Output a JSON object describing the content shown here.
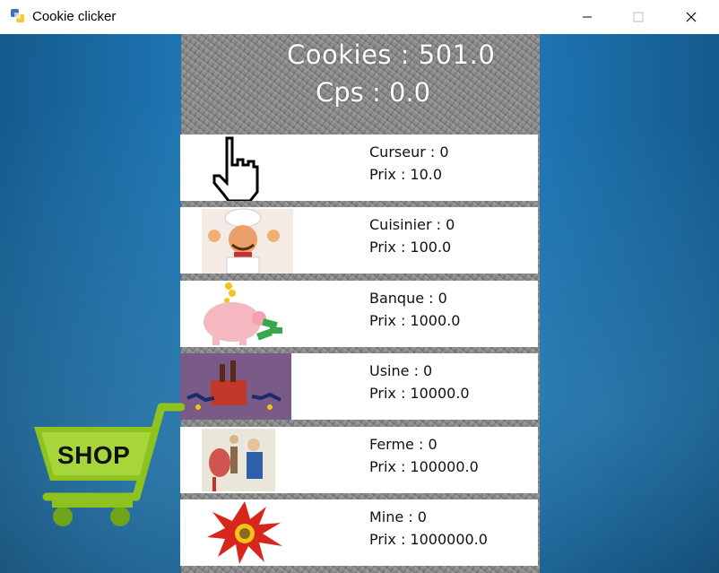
{
  "window": {
    "title": "Cookie clicker",
    "controls": [
      "minimize",
      "maximize",
      "close"
    ]
  },
  "stats": {
    "cookies": "Cookies : 501.0",
    "cps": "Cps : 0.0"
  },
  "shop": {
    "label": "SHOP",
    "items": [
      {
        "name": "Curseur : 0",
        "price": "Prix : 10.0",
        "icon": "cursor-hand-icon"
      },
      {
        "name": "Cuisinier : 0",
        "price": "Prix : 100.0",
        "icon": "chef-icon"
      },
      {
        "name": "Banque : 0",
        "price": "Prix : 1000.0",
        "icon": "piggy-bank-icon"
      },
      {
        "name": "Usine : 0",
        "price": "Prix : 10000.0",
        "icon": "factory-icon"
      },
      {
        "name": "Ferme : 0",
        "price": "Prix : 100000.0",
        "icon": "farm-icon"
      },
      {
        "name": "Mine : 0",
        "price": "Prix : 1000000.0",
        "icon": "explosion-icon"
      }
    ]
  },
  "colors": {
    "background": "#1b6ea8",
    "panel": "#8f8f8f",
    "cart": "#8dc21f"
  }
}
